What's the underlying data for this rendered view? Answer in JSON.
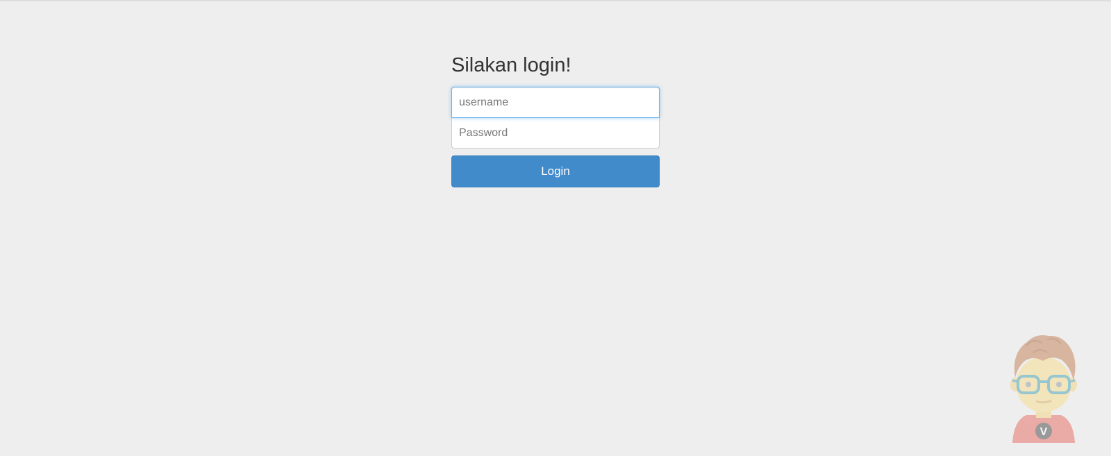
{
  "login": {
    "heading": "Silakan login!",
    "username_placeholder": "username",
    "password_placeholder": "Password",
    "submit_label": "Login"
  },
  "mascot": {
    "icon": "cartoon-boy-mascot-icon",
    "shirt_letter": "V"
  },
  "colors": {
    "background": "#eeeeee",
    "button": "#428bca",
    "focus_border": "#66afe9"
  }
}
